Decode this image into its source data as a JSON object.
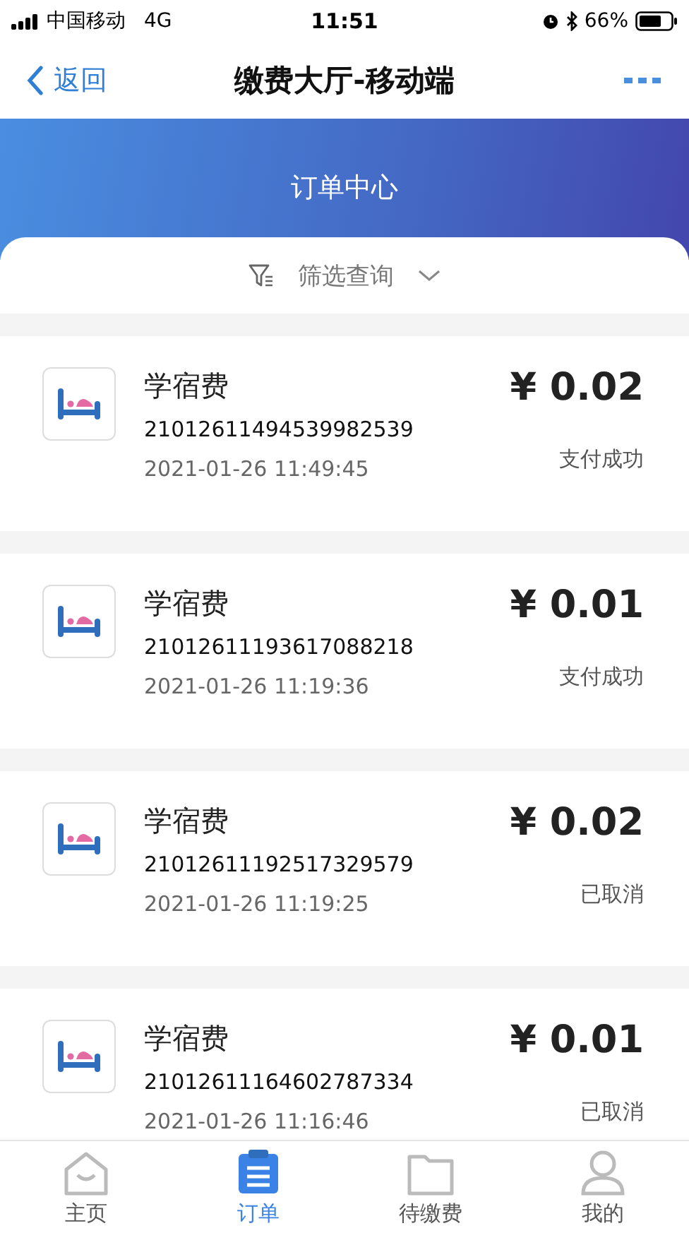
{
  "status_bar": {
    "carrier": "中国移动",
    "network": "4G",
    "time": "11:51",
    "battery": "66%"
  },
  "nav_bar": {
    "back": "返回",
    "title": "缴费大厅-移动端"
  },
  "header": {
    "title": "订单中心"
  },
  "filter": {
    "label": "筛选查询"
  },
  "orders": [
    {
      "name": "学宿费",
      "order_no": "21012611494539982539",
      "time": "2021-01-26 11:49:45",
      "amount": "¥ 0.02",
      "status": "支付成功"
    },
    {
      "name": "学宿费",
      "order_no": "21012611193617088218",
      "time": "2021-01-26 11:19:36",
      "amount": "¥ 0.01",
      "status": "支付成功"
    },
    {
      "name": "学宿费",
      "order_no": "21012611192517329579",
      "time": "2021-01-26 11:19:25",
      "amount": "¥ 0.02",
      "status": "已取消"
    },
    {
      "name": "学宿费",
      "order_no": "21012611164602787334",
      "time": "2021-01-26 11:16:46",
      "amount": "¥ 0.01",
      "status": "已取消"
    }
  ],
  "tab_bar": [
    {
      "kind": "home",
      "label": "主页",
      "selected": false
    },
    {
      "kind": "orders",
      "label": "订单",
      "selected": true
    },
    {
      "kind": "pending",
      "label": "待缴费",
      "selected": false
    },
    {
      "kind": "profile",
      "label": "我的",
      "selected": false
    }
  ]
}
